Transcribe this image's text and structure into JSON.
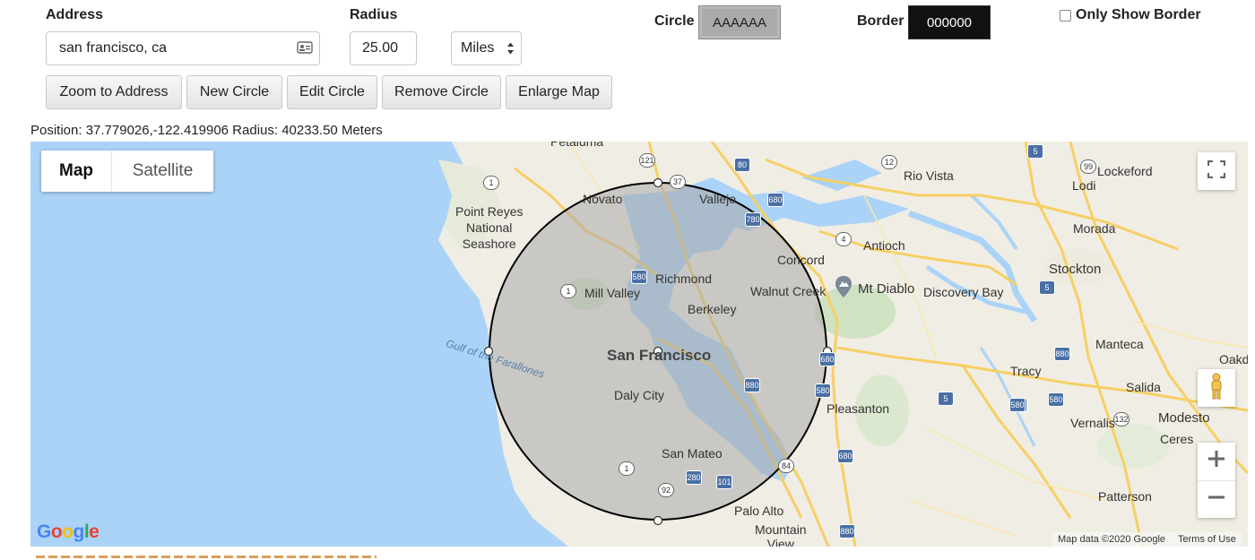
{
  "form": {
    "address_label": "Address",
    "address_value": "san francisco, ca",
    "radius_label": "Radius",
    "radius_value": "25.00",
    "unit_value": "Miles",
    "circle_label": "Circle",
    "circle_color": "AAAAAA",
    "border_label": "Border",
    "border_color": "000000",
    "only_border_label": "Only Show Border",
    "only_border_checked": false
  },
  "buttons": {
    "zoom": "Zoom to Address",
    "new_circle": "New Circle",
    "edit_circle": "Edit Circle",
    "remove_circle": "Remove Circle",
    "enlarge_map": "Enlarge Map"
  },
  "position_line": "Position: 37.779026,-122.419906 Radius: 40233.50 Meters",
  "map": {
    "type_map": "Map",
    "type_satellite": "Satellite",
    "selected_type": "Map",
    "attribution": "Map data ©2020 Google",
    "terms": "Terms of Use",
    "logo_text": "Google",
    "water_color": "#aad3f7",
    "land_color": "#f0ede4",
    "circle_fill": "#AAAAAA",
    "circle_stroke": "#000000",
    "places": {
      "petaluma": "Petaluma",
      "novato": "Novato",
      "vallejo": "Vallejo",
      "point_reyes": "Point Reyes\nNational\nSeashore",
      "mill_valley": "Mill Valley",
      "richmond": "Richmond",
      "berkeley": "Berkeley",
      "concord": "Concord",
      "walnut_creek": "Walnut Creek",
      "mt_diablo": "Mt Diablo",
      "antioch": "Antioch",
      "rio_vista": "Rio Vista",
      "discovery_bay": "Discovery Bay",
      "lockeford": "Lockeford",
      "lodi": "Lodi",
      "morada": "Morada",
      "stockton": "Stockton",
      "manteca": "Manteca",
      "tracy": "Tracy",
      "salida": "Salida",
      "modesto": "Modesto",
      "ceres": "Ceres",
      "vernalis": "Vernalis",
      "patterson": "Patterson",
      "oakdale": "Oakd",
      "pleasanton": "Pleasanton",
      "san_francisco": "San Francisco",
      "daly_city": "Daly City",
      "san_mateo": "San Mateo",
      "palo_alto": "Palo Alto",
      "mountain_view": "Mountain\nView",
      "gulf": "Gulf of the Farallones"
    },
    "routes": [
      "101",
      "121",
      "37",
      "80",
      "12",
      "5",
      "99",
      "1",
      "780",
      "680",
      "4",
      "580",
      "880",
      "680",
      "580",
      "880",
      "5",
      "580",
      "132",
      "5",
      "1",
      "92",
      "280",
      "101",
      "84",
      "680",
      "880",
      "5",
      "580",
      "99"
    ]
  }
}
